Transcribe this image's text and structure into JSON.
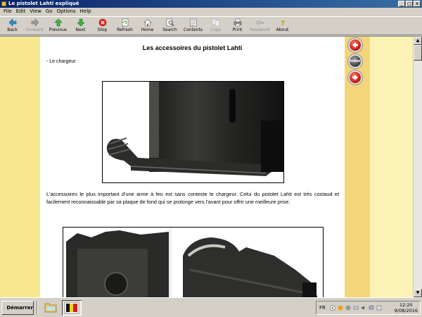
{
  "window": {
    "title": "Le pistolet Lahti expliqué"
  },
  "menu": [
    "File",
    "Edit",
    "View",
    "Go",
    "Options",
    "Help"
  ],
  "toolbar": {
    "back": "Back",
    "forward": "Forward",
    "previous": "Previous",
    "next": "Next",
    "stop": "Stop",
    "refresh": "Refresh",
    "home": "Home",
    "search": "Search",
    "contents": "Contents",
    "copy": "Copy",
    "print": "Print",
    "password": "Password",
    "about": "About"
  },
  "page": {
    "title": "Les accessoires du pistolet Lahti",
    "section": "- Le chargeur",
    "paragraph": "L'accessoires le plus important d'une arme à feu est sans conteste le chargeur. Celui du pistolet Lahti est très costaud et facilement reconnaissable par sa plaque de fond qui se prolonge vers l'avant pour offrir une meilleure prise."
  },
  "side_nav": {
    "mid_label": "Index"
  },
  "taskbar": {
    "start_label": "Démarrer",
    "language": "FR",
    "time": "12:20",
    "date": "9/08/2016"
  },
  "colors": {
    "title_bar_start": "#0a246a",
    "title_bar_end": "#3a6ea5",
    "page_band_left": "#f7e78f",
    "page_band_right": "#f4d67a",
    "nav_button_red": "#c0140a"
  }
}
